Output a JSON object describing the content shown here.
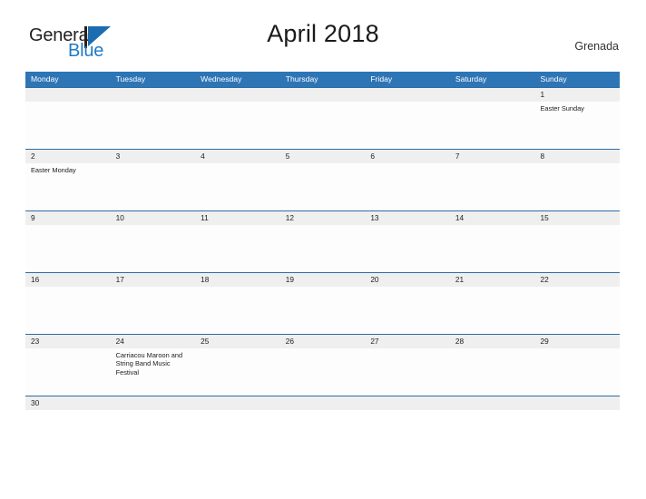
{
  "brand": {
    "name_part1": "General",
    "name_part2": "Blue",
    "accent_color": "#1f7ac4"
  },
  "header": {
    "title": "April 2018",
    "location": "Grenada"
  },
  "calendar": {
    "header_color": "#2e75b6",
    "weekdays": [
      "Monday",
      "Tuesday",
      "Wednesday",
      "Thursday",
      "Friday",
      "Saturday",
      "Sunday"
    ],
    "weeks": [
      {
        "days": [
          {
            "num": "",
            "event": ""
          },
          {
            "num": "",
            "event": ""
          },
          {
            "num": "",
            "event": ""
          },
          {
            "num": "",
            "event": ""
          },
          {
            "num": "",
            "event": ""
          },
          {
            "num": "",
            "event": ""
          },
          {
            "num": "1",
            "event": "Easter Sunday"
          }
        ]
      },
      {
        "days": [
          {
            "num": "2",
            "event": "Easter Monday"
          },
          {
            "num": "3",
            "event": ""
          },
          {
            "num": "4",
            "event": ""
          },
          {
            "num": "5",
            "event": ""
          },
          {
            "num": "6",
            "event": ""
          },
          {
            "num": "7",
            "event": ""
          },
          {
            "num": "8",
            "event": ""
          }
        ]
      },
      {
        "days": [
          {
            "num": "9",
            "event": ""
          },
          {
            "num": "10",
            "event": ""
          },
          {
            "num": "11",
            "event": ""
          },
          {
            "num": "12",
            "event": ""
          },
          {
            "num": "13",
            "event": ""
          },
          {
            "num": "14",
            "event": ""
          },
          {
            "num": "15",
            "event": ""
          }
        ]
      },
      {
        "days": [
          {
            "num": "16",
            "event": ""
          },
          {
            "num": "17",
            "event": ""
          },
          {
            "num": "18",
            "event": ""
          },
          {
            "num": "19",
            "event": ""
          },
          {
            "num": "20",
            "event": ""
          },
          {
            "num": "21",
            "event": ""
          },
          {
            "num": "22",
            "event": ""
          }
        ]
      },
      {
        "days": [
          {
            "num": "23",
            "event": ""
          },
          {
            "num": "24",
            "event": "Carriacou Maroon and String Band Music Festival"
          },
          {
            "num": "25",
            "event": ""
          },
          {
            "num": "26",
            "event": ""
          },
          {
            "num": "27",
            "event": ""
          },
          {
            "num": "28",
            "event": ""
          },
          {
            "num": "29",
            "event": ""
          }
        ]
      },
      {
        "short": true,
        "days": [
          {
            "num": "30",
            "event": ""
          },
          {
            "num": "",
            "event": ""
          },
          {
            "num": "",
            "event": ""
          },
          {
            "num": "",
            "event": ""
          },
          {
            "num": "",
            "event": ""
          },
          {
            "num": "",
            "event": ""
          },
          {
            "num": "",
            "event": ""
          }
        ]
      }
    ]
  }
}
